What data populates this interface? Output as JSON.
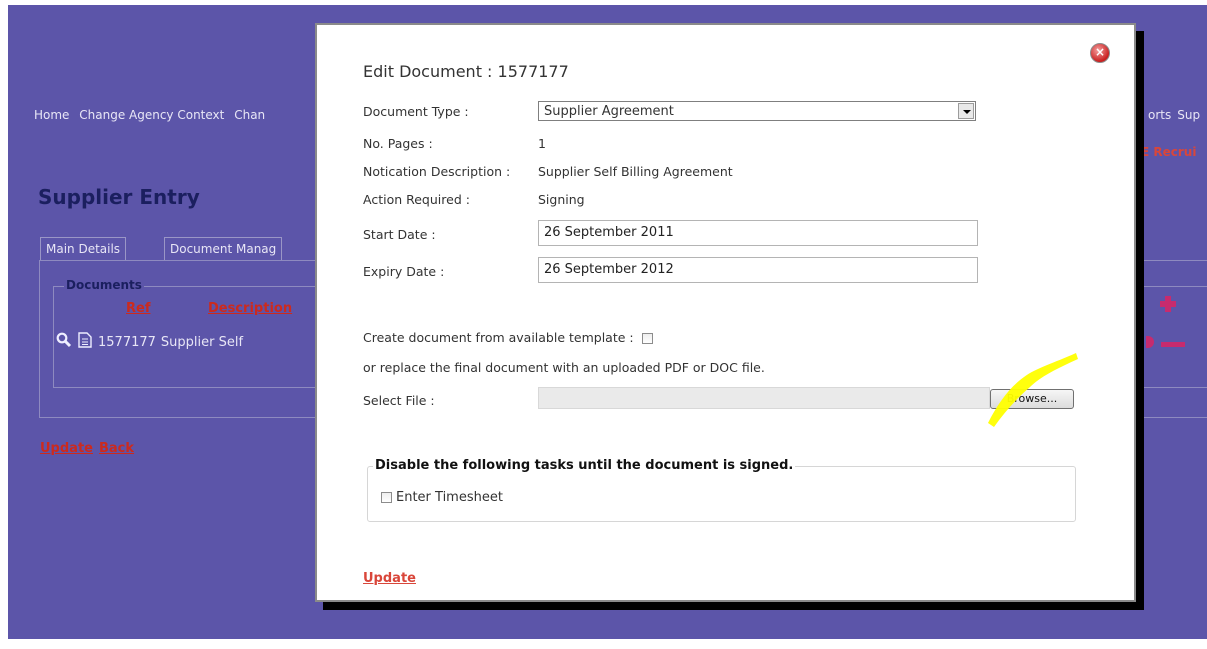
{
  "nav": {
    "left_items": [
      "Home",
      "Change Agency Context",
      "Chan"
    ],
    "right_items": [
      "orts",
      "Sup"
    ],
    "recruit_text": "E Recrui"
  },
  "page": {
    "title": "Supplier Entry",
    "tabs": [
      "Main Details",
      "Document Manag"
    ],
    "documents_legend": "Documents",
    "columns": {
      "ref": "Ref",
      "description": "Description"
    },
    "row": {
      "ref": "1577177",
      "description": "Supplier Self"
    },
    "links": {
      "update": "Update",
      "back": "Back"
    }
  },
  "modal": {
    "title": "Edit Document : 1577177",
    "document_type": {
      "label": "Document Type :",
      "value": "Supplier Agreement"
    },
    "no_pages": {
      "label": "No. Pages :",
      "value": "1"
    },
    "notication_description": {
      "label": "Notication Description :",
      "value": "Supplier Self Billing Agreement"
    },
    "action_required": {
      "label": "Action Required :",
      "value": "Signing"
    },
    "start_date": {
      "label": "Start Date :",
      "value": "26 September 2011"
    },
    "expiry_date": {
      "label": "Expiry Date :",
      "value": "26 September 2012"
    },
    "create_template_label": "Create document from available template :",
    "replace_text": "or replace the final document with an uploaded PDF or DOC file.",
    "select_file_label": "Select File :",
    "browse_label": "Browse...",
    "disable_legend": "Disable the following tasks until the document is signed.",
    "task_enter_timesheet": "Enter Timesheet",
    "update_label": "Update"
  },
  "colors": {
    "background": "#5c55a9",
    "link_red": "#d9463a",
    "title_navy": "#1b1f5f",
    "highlight_yellow": "#ffff00"
  }
}
